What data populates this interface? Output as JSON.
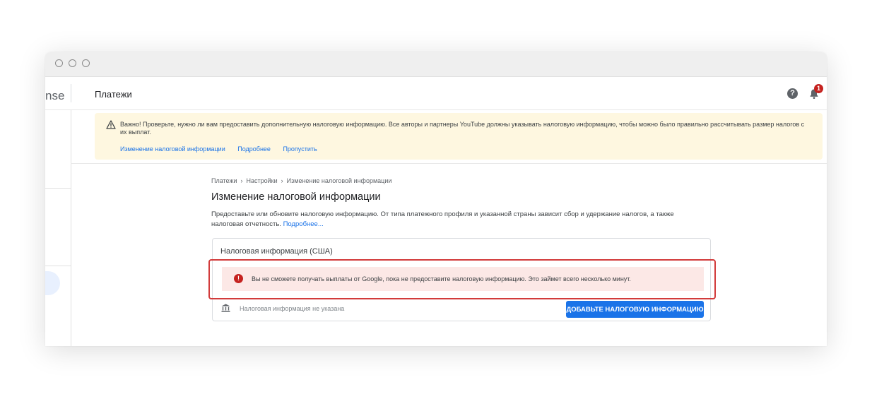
{
  "header": {
    "brand_partial": "nse",
    "title": "Платежи",
    "help_icon": "help-circle-icon",
    "notifications_icon": "bell-icon",
    "notification_count": "1"
  },
  "notice": {
    "icon": "warning-triangle-icon",
    "text": "Важно! Проверьте, нужно ли вам предоставить дополнительную налоговую информацию. Все авторы и партнеры YouTube должны указывать налоговую информацию, чтобы можно было правильно рассчитывать размер налогов с их выплат.",
    "links": [
      "Изменение налоговой информации",
      "Подробнее",
      "Пропустить"
    ]
  },
  "breadcrumb": [
    "Платежи",
    "Настройки",
    "Изменение налоговой информации"
  ],
  "content": {
    "title": "Изменение налоговой информации",
    "description": "Предоставьте или обновите налоговую информацию. От типа платежного профиля и указанной страны зависит сбор и удержание налогов, а также налоговая отчетность.",
    "description_link": "Подробнее..."
  },
  "card": {
    "title": "Налоговая информация (США)",
    "error_icon": "error-circle-icon",
    "error_text": "Вы не сможете получать выплаты от Google, пока не предоставите налоговую информацию. Это займет всего несколько минут.",
    "status_icon": "bank-icon",
    "status_text": "Налоговая информация не указана",
    "button_label": "ДОБАВЬТЕ НАЛОГОВУЮ ИНФОРМАЦИЮ"
  },
  "colors": {
    "accent": "#1a73e8",
    "error": "#c5221f",
    "highlight": "#d23b3b",
    "notice_bg": "#fef7e0",
    "error_bg": "#fce8e6"
  }
}
